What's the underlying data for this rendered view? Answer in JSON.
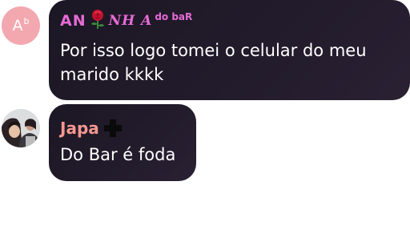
{
  "messages": [
    {
      "avatar": {
        "initial": "A",
        "superscript": "b",
        "bg_color": "#f3a8b0"
      },
      "sender": {
        "name_part1": "AN",
        "icon": "rose-icon",
        "name_part2": "NH A",
        "suffix": "do baR",
        "color": "#e56bd6"
      },
      "text": "Por isso logo tomei o celular do meu marido kkkk"
    },
    {
      "avatar": {
        "icon": "profile-photo"
      },
      "sender": {
        "name": "Japa",
        "icon": "black-cross-icon",
        "color": "#f4978e"
      },
      "text": "Do Bar é foda"
    }
  ],
  "colors": {
    "bubble_background": "#1f1828",
    "message_text": "#ffffff"
  }
}
